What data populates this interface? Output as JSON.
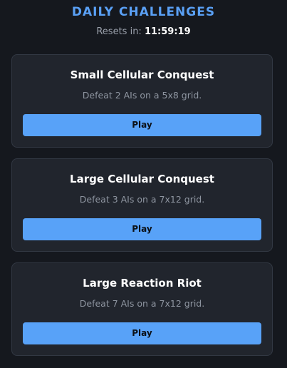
{
  "header": {
    "title": "DAILY CHALLENGES",
    "reset_label": "Resets in:",
    "reset_time": "11:59:19"
  },
  "challenges": [
    {
      "title": "Small Cellular Conquest",
      "description": "Defeat 2 AIs on a 5x8 grid.",
      "button_label": "Play"
    },
    {
      "title": "Large Cellular Conquest",
      "description": "Defeat 3 AIs on a 7x12 grid.",
      "button_label": "Play"
    },
    {
      "title": "Large Reaction Riot",
      "description": "Defeat 7 AIs on a 7x12 grid.",
      "button_label": "Play"
    }
  ],
  "colors": {
    "background": "#15181e",
    "card": "#21252d",
    "accent": "#58a2f8",
    "title": "#5aa0f5"
  }
}
